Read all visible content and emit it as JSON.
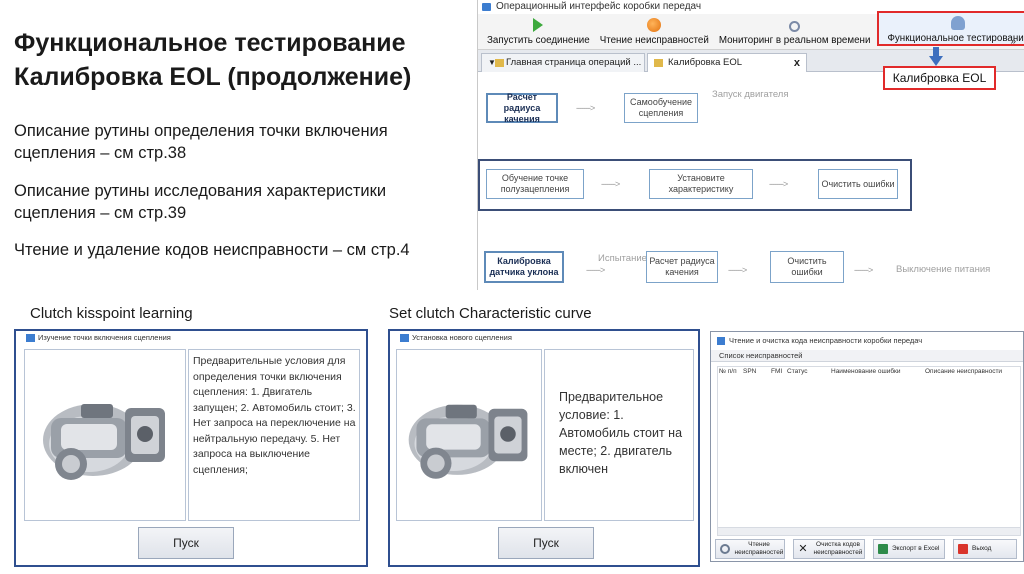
{
  "slide": {
    "title_line1": "Функциональное тестирование",
    "title_line2": "Калибровка EOL (продолжение)",
    "para1_line1": "Описание рутины определения точки включения",
    "para1_line2": "сцепления – см стр.38",
    "para2_line1": "Описание рутины исследования характеристики",
    "para2_line2": "сцепления – см стр.39",
    "para3": "Чтение и удаление кодов неисправности – см стр.4",
    "caption_left": "Clutch kisspoint learning",
    "caption_middle": "Set clutch Characteristic curve"
  },
  "app": {
    "title": "Операционный интерфейс коробки передач",
    "toolbar": {
      "connect": "Запустить соединение",
      "read_faults": "Чтение неисправностей",
      "monitoring": "Мониторинг в реальном времени",
      "functional_test": "Функциональное тестирование",
      "more": "»"
    },
    "tabs": {
      "home": "Главная страница операций ...",
      "eol": "Калибровка EOL",
      "close": "x"
    },
    "callout": "Калибровка EOL",
    "flow": {
      "radius_calc": "Расчет радиуса качения",
      "self_learning": "Самообучение сцепления",
      "engine_start": "Запуск двигателя",
      "kisspoint_learning": "Обучение точке полузацепления",
      "set_characteristic": "Установите характеристику",
      "clear_errors_1": "Очистить ошибки",
      "slope_sensor": "Калибровка датчика уклона",
      "drum_test": "Испытание барабана",
      "radius_calc_2": "Расчет радиуса качения",
      "clear_errors_2": "Очистить ошибки",
      "power_off": "Выключение питания",
      "arrow": "------->"
    }
  },
  "dialog_kisspoint": {
    "title": "Изучение точки включения сцепления",
    "text": "Предварительные условия для определения точки включения сцепления: 1. Двигатель запущен; 2. Автомобиль стоит; 3. Нет запроса на переключение на нейтральную передачу. 5. Нет запроса на выключение сцепления;",
    "start": "Пуск"
  },
  "dialog_clutch_curve": {
    "title": "Установка нового сцепления",
    "text": "Предварительное условие: 1. Автомобиль стоит на месте; 2. двигатель включен",
    "start": "Пуск"
  },
  "error_window": {
    "title": "Чтение и очистка кода неисправности коробки передач",
    "subtitle": "Список неисправностей",
    "columns": [
      "№ п/п",
      "SPN",
      "FMI",
      "Статус",
      "Наименование ошибки",
      "Описание неисправности"
    ],
    "buttons": {
      "read": "Чтение неисправностей",
      "clear": "Очистка кодов неисправностей",
      "export": "Экспорт в Excel",
      "exit": "Выход"
    }
  },
  "colors": {
    "accent_red": "#e12a2a",
    "frame_blue": "#2f4f8f",
    "arrow_blue": "#3e6fbe"
  }
}
